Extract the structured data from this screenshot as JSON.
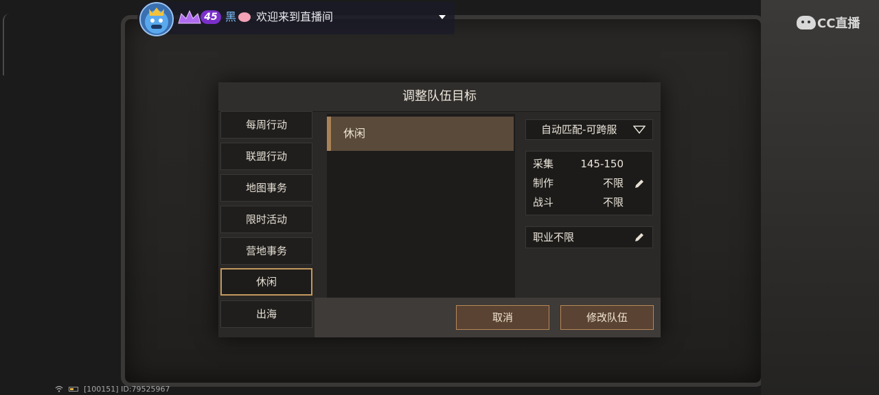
{
  "stream": {
    "level": "45",
    "username": "黑",
    "welcome_text": "欢迎来到直播间",
    "logo_text": "CC直播"
  },
  "modal": {
    "title": "调整队伍目标",
    "categories": [
      {
        "label": "每周行动"
      },
      {
        "label": "联盟行动"
      },
      {
        "label": "地图事务"
      },
      {
        "label": "限时活动"
      },
      {
        "label": "营地事务"
      },
      {
        "label": "休闲",
        "active": true
      },
      {
        "label": "出海"
      }
    ],
    "list_items": [
      "休闲"
    ],
    "match_select": "自动匹配-可跨服",
    "requirements": [
      {
        "label": "采集",
        "value": "145-150"
      },
      {
        "label": "制作",
        "value": "不限"
      },
      {
        "label": "战斗",
        "value": "不限"
      }
    ],
    "job": "职业不限",
    "cancel_label": "取消",
    "confirm_label": "修改队伍"
  },
  "status_bar": {
    "text": "[100151] ID:79525967"
  },
  "colors": {
    "accent_border": "#c59a5e",
    "selected_row": "#5a4a3a",
    "button_bg": "#5a4332",
    "level_badge": "#7a2fc9"
  }
}
